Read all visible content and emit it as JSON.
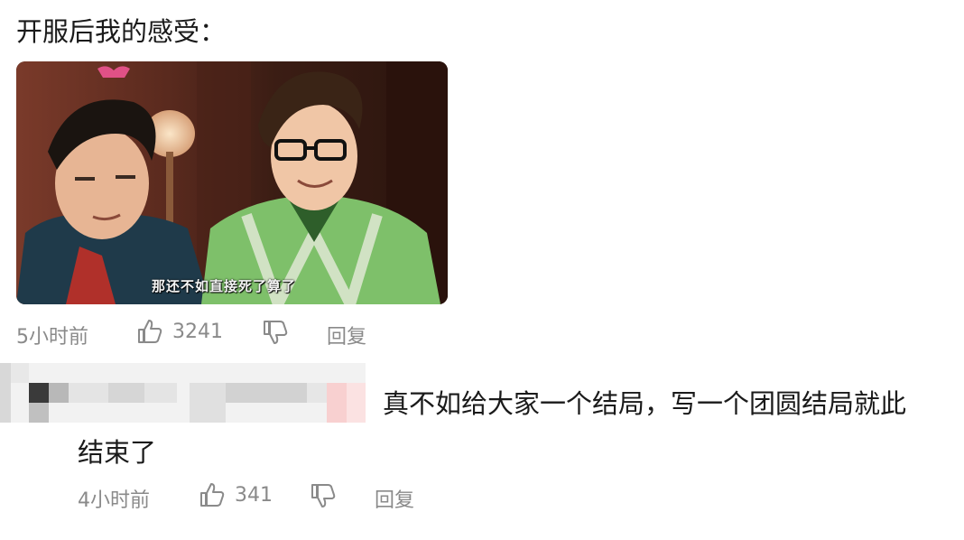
{
  "comment1": {
    "text": "开服后我的感受：",
    "media_caption": "那还不如直接死了算了",
    "time": "5小时前",
    "likes": "3241",
    "reply_label": "回复"
  },
  "comment2": {
    "text_line1": "真不如给大家一个结局，写一个团圆结局就此",
    "text_line2": "结束了",
    "time": "4小时前",
    "likes": "341",
    "reply_label": "回复"
  },
  "icons": {
    "like": "thumbs-up-icon",
    "dislike": "thumbs-down-icon"
  },
  "colors": {
    "meta_text": "#8a8a8a",
    "body_text": "#1a1a1a"
  }
}
